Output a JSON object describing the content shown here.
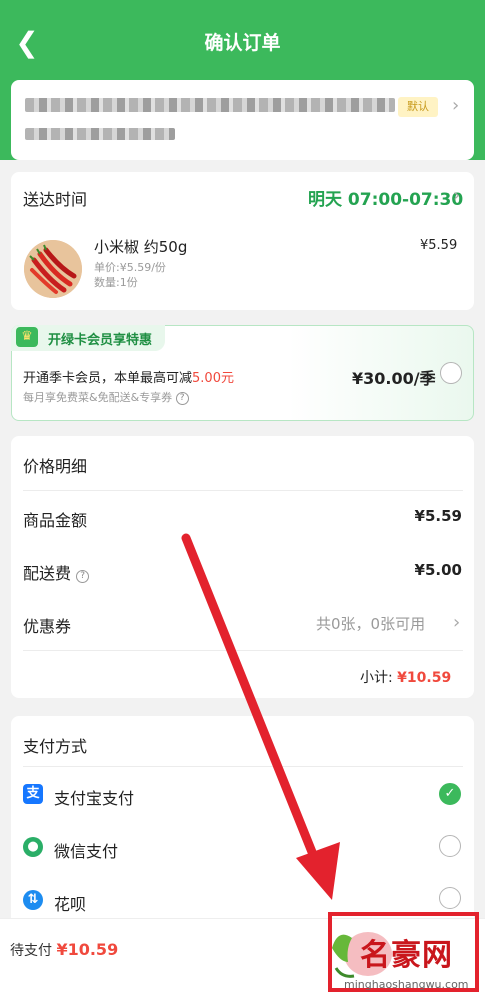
{
  "header": {
    "title": "确认订单",
    "back_icon": "chevron-left-icon"
  },
  "address": {
    "default_tag": "默认"
  },
  "delivery": {
    "label": "送达时间",
    "time": "明天 07:00-07:30",
    "product": {
      "name": "小米椒 约50g",
      "unit_price": "单价:¥5.59/份",
      "quantity": "数量:1份",
      "price": "¥5.59"
    }
  },
  "member": {
    "badge": "开绿卡会员享特惠",
    "offer_prefix": "开通季卡会员，本单最高可减",
    "offer_amount": "5.00元",
    "perks": "每月享免费菜&免配送&专享券",
    "price": "¥30.00/季"
  },
  "price_detail": {
    "title": "价格明细",
    "goods_label": "商品金额",
    "goods_value": "¥5.59",
    "shipping_label": "配送费",
    "shipping_value": "¥5.00",
    "coupon_label": "优惠券",
    "coupon_value": "共0张，0张可用",
    "subtotal_label": "小计:",
    "subtotal_value": "¥10.59"
  },
  "payment": {
    "title": "支付方式",
    "methods": [
      {
        "label": "支付宝支付",
        "icon": "alipay-icon",
        "selected": true
      },
      {
        "label": "微信支付",
        "icon": "wechat-pay-icon",
        "selected": false
      },
      {
        "label": "花呗",
        "icon": "huabei-icon",
        "selected": false
      }
    ]
  },
  "bottom": {
    "to_pay_label": "待支付",
    "to_pay_value": "¥10.59"
  },
  "watermark": {
    "brand": "名豪网",
    "url": "minghaoshangwu.com"
  },
  "colors": {
    "brand_green": "#3cb95c",
    "price_red": "#f0493d",
    "annotation_red": "#e3222d"
  }
}
